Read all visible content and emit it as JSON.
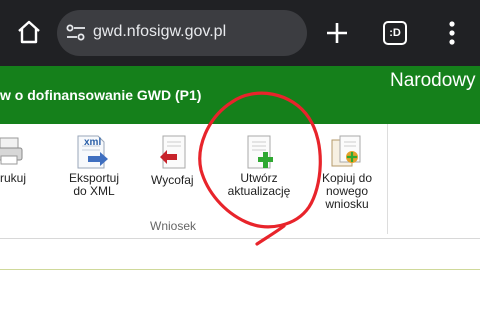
{
  "browser": {
    "url": "gwd.nfosigw.gov.pl",
    "tabs_count": ":D"
  },
  "header": {
    "form_title": "w o dofinansowanie GWD (P1)",
    "org_name": "Narodowy"
  },
  "ribbon": {
    "buttons": [
      {
        "label": "rukuj",
        "icon": "print-icon"
      },
      {
        "label": "Eksportuj\ndo XML",
        "icon": "xml-export-icon"
      },
      {
        "label": "Wycofaj",
        "icon": "withdraw-icon"
      },
      {
        "label": "Utwórz\naktualizację",
        "icon": "create-update-icon"
      },
      {
        "label": "Kopiuj do\nnowego\nwniosku",
        "icon": "copy-to-new-icon"
      }
    ],
    "group_label": "Wniosek"
  },
  "colors": {
    "browser_bar": "#202124",
    "header_green": "#15801b",
    "annotation_red": "#e8242b"
  }
}
